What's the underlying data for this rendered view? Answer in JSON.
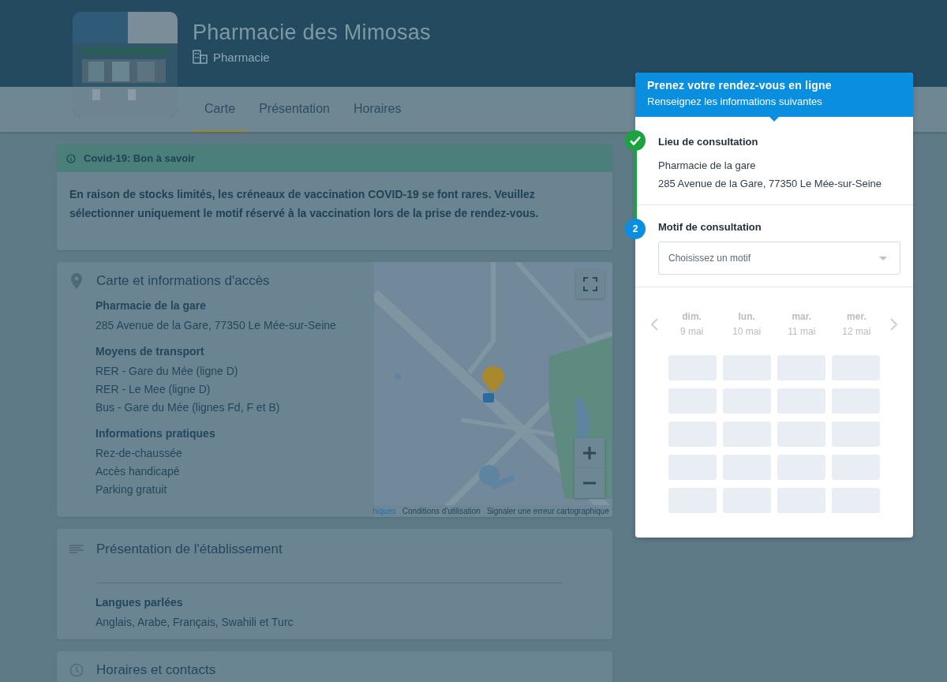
{
  "header": {
    "title": "Pharmacie des Mimosas",
    "category": "Pharmacie"
  },
  "tabs": [
    {
      "label": "Carte",
      "selected": true
    },
    {
      "label": "Présentation",
      "selected": false
    },
    {
      "label": "Horaires",
      "selected": false
    }
  ],
  "notice": {
    "title": "Covid-19: Bon à savoir",
    "text": "En raison de stocks limités, les créneaux de vaccination COVID-19 se font rares. Veuillez sélectionner uniquement le motif réservé à la vaccination lors de la prise de rendez-vous."
  },
  "access": {
    "title": "Carte et informations d'accès",
    "sections": [
      {
        "heading": "Pharmacie de la gare",
        "lines": [
          "285 Avenue de la Gare, 77350 Le Mée-sur-Seine"
        ]
      },
      {
        "heading": "Moyens de transport",
        "lines": [
          "RER - Gare du Mée (ligne D)",
          "RER - Le Mee (ligne D)",
          "Bus - Gare du Mée (lignes Fd, F et B)"
        ]
      },
      {
        "heading": "Informations pratiques",
        "lines": [
          "Rez-de-chaussée",
          "Accès handicapé",
          "Parking gratuit"
        ]
      }
    ],
    "map": {
      "kind": "picture",
      "attribution": [
        "hiques",
        "Conditions d'utilisation",
        "Signaler une erreur cartographique"
      ]
    }
  },
  "presentation": {
    "title": "Présentation de l'établissement",
    "languages_heading": "Langues parlées",
    "languages": "Anglais, Arabe, Français, Swahili et Turc"
  },
  "hours": {
    "title": "Horaires et contacts"
  },
  "booking": {
    "title": "Prenez votre rendez-vous en ligne",
    "subtitle": "Renseignez les informations suivantes",
    "steps": [
      {
        "kind": "done",
        "title": "Lieu de consultation",
        "lines": [
          "Pharmacie de la gare",
          "285 Avenue de la Gare, 77350 Le Mée-sur-Seine"
        ]
      },
      {
        "kind": "current",
        "number": "2",
        "title": "Motif de consultation",
        "placeholder": "Choisissez un motif"
      }
    ],
    "days": [
      {
        "weekday": "dim.",
        "date": "9 mai",
        "slots": [
          {
            "kind": "placeholder"
          },
          {
            "kind": "placeholder"
          },
          {
            "kind": "placeholder"
          },
          {
            "kind": "placeholder"
          },
          {
            "kind": "placeholder"
          }
        ]
      },
      {
        "weekday": "lun.",
        "date": "10 mai",
        "slots": [
          {
            "kind": "placeholder"
          },
          {
            "kind": "placeholder"
          },
          {
            "kind": "placeholder"
          },
          {
            "kind": "placeholder"
          },
          {
            "kind": "placeholder"
          }
        ]
      },
      {
        "weekday": "mar.",
        "date": "11 mai",
        "slots": [
          {
            "kind": "placeholder"
          },
          {
            "kind": "placeholder"
          },
          {
            "kind": "placeholder"
          },
          {
            "kind": "placeholder"
          },
          {
            "kind": "placeholder"
          }
        ]
      },
      {
        "weekday": "mer.",
        "date": "12 mai",
        "slots": [
          {
            "kind": "placeholder"
          },
          {
            "kind": "placeholder"
          },
          {
            "kind": "placeholder"
          },
          {
            "kind": "placeholder"
          },
          {
            "kind": "placeholder"
          }
        ]
      }
    ]
  }
}
